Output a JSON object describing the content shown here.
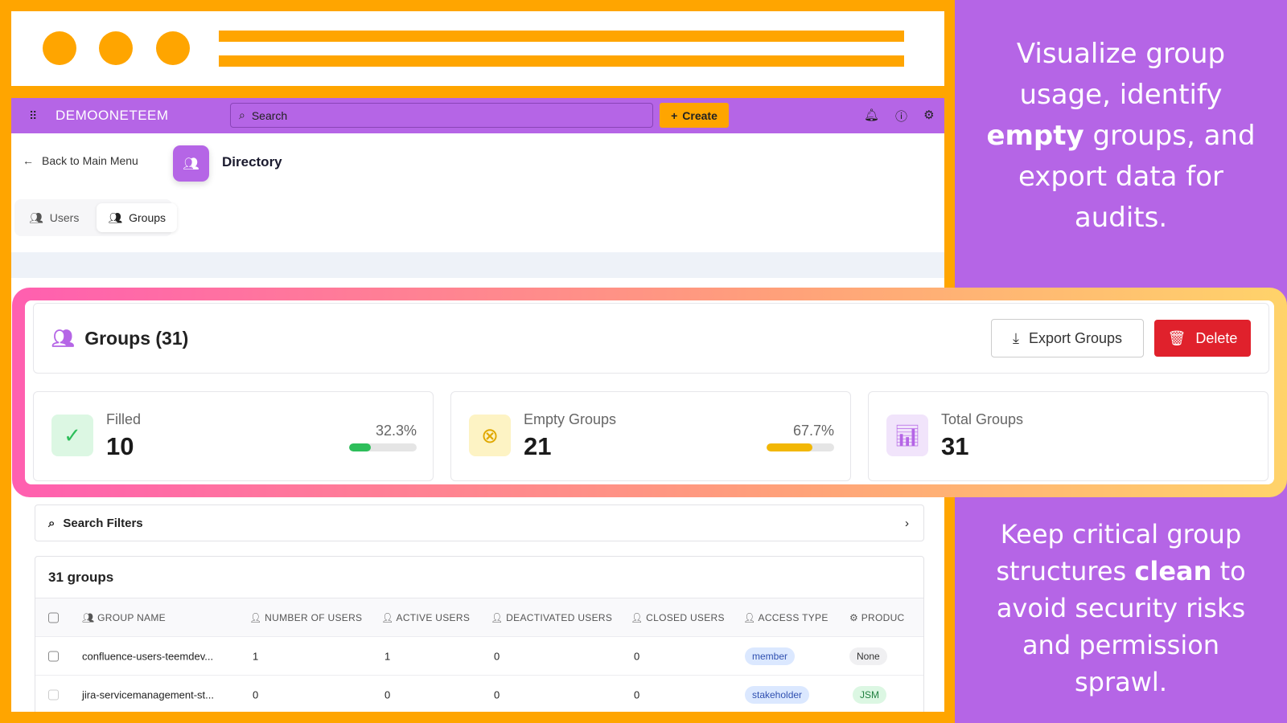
{
  "header": {
    "logo": "DEMOONETEEM",
    "search_placeholder": "Search",
    "create_label": "Create"
  },
  "nav": {
    "back_label": "Back to Main Menu",
    "title": "Directory",
    "tabs": [
      {
        "label": "Users"
      },
      {
        "label": "Groups"
      }
    ]
  },
  "groups": {
    "title": "Groups (31)",
    "export_label": "Export Groups",
    "delete_label": "Delete"
  },
  "stats": [
    {
      "label": "Filled",
      "value": "10",
      "percent": "32.3%",
      "fraction": 0.323,
      "color": "#2DBE5A"
    },
    {
      "label": "Empty Groups",
      "value": "21",
      "percent": "67.7%",
      "fraction": 0.677,
      "color": "#F2B705"
    },
    {
      "label": "Total Groups",
      "value": "31"
    }
  ],
  "filters": {
    "label": "Search Filters"
  },
  "table": {
    "count": "31 groups",
    "columns": [
      "GROUP NAME",
      "NUMBER OF USERS",
      "ACTIVE USERS",
      "DEACTIVATED USERS",
      "CLOSED USERS",
      "ACCESS TYPE",
      "PRODUC"
    ],
    "rows": [
      [
        "confluence-users-teemdev...",
        "1",
        "1",
        "0",
        "0",
        "member",
        "None"
      ],
      [
        "jira-servicemanagement-st...",
        "0",
        "0",
        "0",
        "0",
        "stakeholder",
        "JSM"
      ]
    ]
  },
  "promo": {
    "top_1": "Visualize group usage, identify",
    "top_bold": "empty",
    "top_2": "groups, and export data for audits.",
    "bottom_1": "Keep critical group structures",
    "bottom_bold": "clean",
    "bottom_2": "to avoid security risks and permission sprawl."
  },
  "colors": {
    "frame": "#FFA500",
    "purple": "#B565E6",
    "danger": "#E0212C"
  }
}
